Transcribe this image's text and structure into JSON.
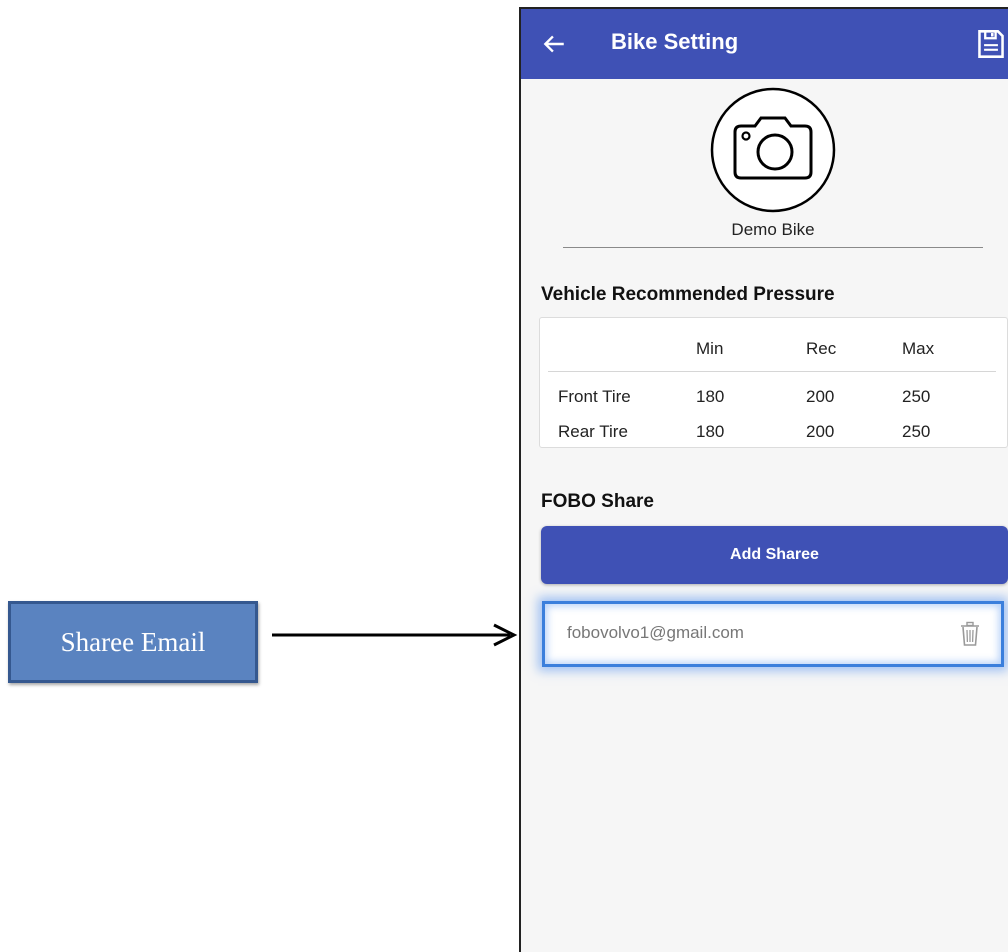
{
  "annotation": {
    "label": "Sharee Email"
  },
  "appbar": {
    "title": "Bike Setting",
    "back_icon": "arrow-left-icon",
    "save_icon": "save-floppy-icon",
    "color": "#3f51b5"
  },
  "bike": {
    "photo_icon": "camera-icon",
    "name": "Demo Bike"
  },
  "pressure": {
    "section_title": "Vehicle Recommended Pressure",
    "headers": [
      "",
      "Min",
      "Rec",
      "Max"
    ],
    "rows": [
      {
        "label": "Front Tire",
        "min": "180",
        "rec": "200",
        "max": "250"
      },
      {
        "label": "Rear Tire",
        "min": "180",
        "rec": "200",
        "max": "250"
      }
    ]
  },
  "share": {
    "section_title": "FOBO Share",
    "add_button_label": "Add Sharee",
    "sharees": [
      {
        "email": "fobovolvo1@gmail.com",
        "delete_icon": "trash-icon"
      }
    ],
    "highlight_color": "#3b7fdc"
  }
}
